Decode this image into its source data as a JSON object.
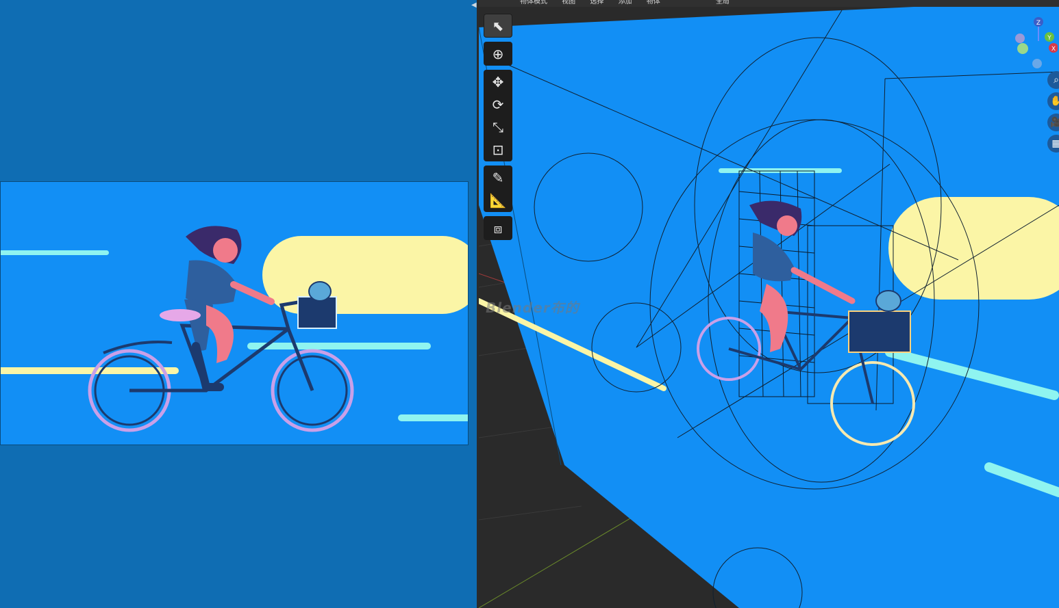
{
  "header": {
    "mode_label": "物体模式",
    "menu": [
      "视图",
      "选择",
      "添加",
      "物体"
    ],
    "orientation_label": "全局"
  },
  "viewport": {
    "watermark": "Blender布的"
  },
  "gizmo": {
    "axes": [
      "Z",
      "Y",
      "X"
    ]
  },
  "toolbar": {
    "tools": [
      "select-box",
      "cursor",
      "move",
      "rotate",
      "scale",
      "transform",
      "annotate",
      "measure",
      "add-cube"
    ]
  },
  "colors": {
    "background_blue": "#128ff5",
    "cream_stripe": "#fbf5a6",
    "cyan_stripe": "#8ff4f0",
    "viewport_grey": "#2a2a2a"
  }
}
